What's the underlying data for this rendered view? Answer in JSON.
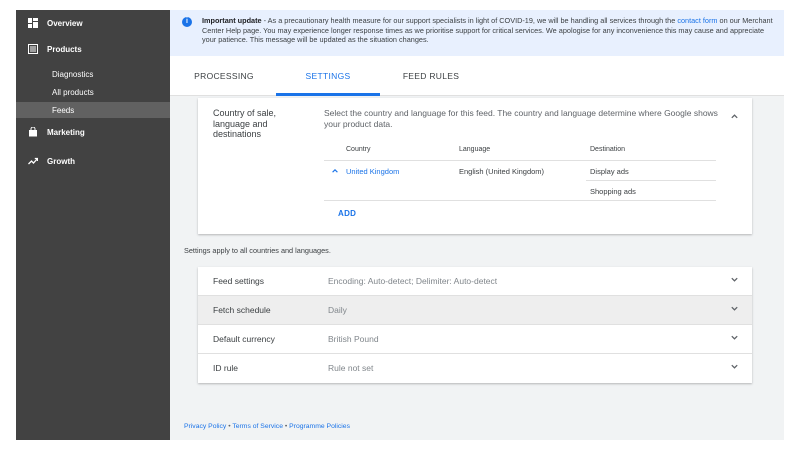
{
  "sidebar": {
    "items": [
      {
        "label": "Overview",
        "icon": "dashboard-icon"
      },
      {
        "label": "Products",
        "icon": "list-icon"
      },
      {
        "label": "Marketing",
        "icon": "shopping-bag-icon"
      },
      {
        "label": "Growth",
        "icon": "trending-up-icon"
      }
    ],
    "sub_items": [
      {
        "label": "Diagnostics",
        "active": false
      },
      {
        "label": "All products",
        "active": false
      },
      {
        "label": "Feeds",
        "active": true
      }
    ]
  },
  "banner": {
    "icon": "info-icon",
    "title": "Important update",
    "text_before_link": " - As a precautionary health measure for our support specialists in light of COVID-19, we will be handling all services through the ",
    "link": "contact form",
    "text_after_link": " on our Merchant Center Help page. You may experience longer response times as we prioritise support for critical services. We apologise for any inconvenience this may cause and appreciate your patience. This message will be updated as the situation changes."
  },
  "tabs": [
    {
      "label": "PROCESSING",
      "active": false
    },
    {
      "label": "SETTINGS",
      "active": true
    },
    {
      "label": "FEED RULES",
      "active": false
    }
  ],
  "country_card": {
    "title": "Country of sale, language and destinations",
    "description": "Select the country and language for this feed. The country and language determine where Google shows your product data.",
    "columns": [
      "Country",
      "Language",
      "Destination"
    ],
    "row": {
      "country": "United Kingdom",
      "language": "English (United Kingdom)",
      "destinations": [
        "Display ads",
        "Shopping ads"
      ]
    },
    "add_label": "ADD"
  },
  "apply_note": "Settings apply to all countries and languages.",
  "settings": [
    {
      "label": "Feed settings",
      "value": "Encoding: Auto-detect; Delimiter: Auto-detect",
      "hover": false
    },
    {
      "label": "Fetch schedule",
      "value": "Daily",
      "hover": true
    },
    {
      "label": "Default currency",
      "value": "British Pound",
      "hover": false
    },
    {
      "label": "ID rule",
      "value": "Rule not set",
      "hover": false
    }
  ],
  "footer": {
    "links": [
      "Privacy Policy",
      "Terms of Service",
      "Programme Policies"
    ],
    "separator": "•"
  },
  "colors": {
    "sidebar_bg": "#424242",
    "accent": "#1a73e8",
    "banner_bg": "#e8f0fe",
    "page_bg": "#f1f3f4"
  }
}
